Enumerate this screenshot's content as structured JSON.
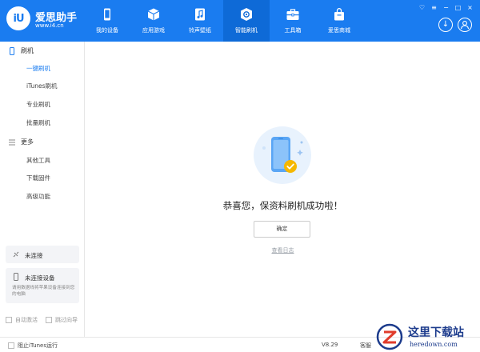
{
  "app": {
    "logo_text": "iU",
    "name": "爱思助手",
    "url": "www.i4.cn"
  },
  "nav": [
    {
      "label": "我的设备",
      "icon": "phone-icon"
    },
    {
      "label": "应用游戏",
      "icon": "cube-icon"
    },
    {
      "label": "铃声壁纸",
      "icon": "ringtone-icon"
    },
    {
      "label": "智能刷机",
      "icon": "flash-icon",
      "active": true
    },
    {
      "label": "工具箱",
      "icon": "toolbox-icon"
    },
    {
      "label": "爱思商城",
      "icon": "bag-icon"
    }
  ],
  "sidebar": {
    "flash_section": "刷机",
    "flash_items": [
      "一键刷机",
      "iTunes刷机",
      "专业刷机",
      "批量刷机"
    ],
    "more_section": "更多",
    "more_items": [
      "其他工具",
      "下载固件",
      "高级功能"
    ],
    "active_item": "一键刷机",
    "device_status": "未连接",
    "device_box_title": "未连接设备",
    "device_box_desc": "请用数据线将苹果设备连接到您的电脑",
    "auto_activate": "自动激活",
    "skip_guide": "跳过向导"
  },
  "main": {
    "success_message": "恭喜您，保资料刷机成功啦！",
    "confirm_button": "确定",
    "view_log": "查看日志"
  },
  "statusbar": {
    "block_itunes": "阻止iTunes运行",
    "version": "V8.29",
    "service": "客服"
  },
  "watermark": {
    "text": "这里下载站",
    "sub": "heredown.com"
  },
  "colors": {
    "brand": "#1a7cf0",
    "brand_active": "#0e6ad7",
    "success_check": "#f5b700"
  }
}
